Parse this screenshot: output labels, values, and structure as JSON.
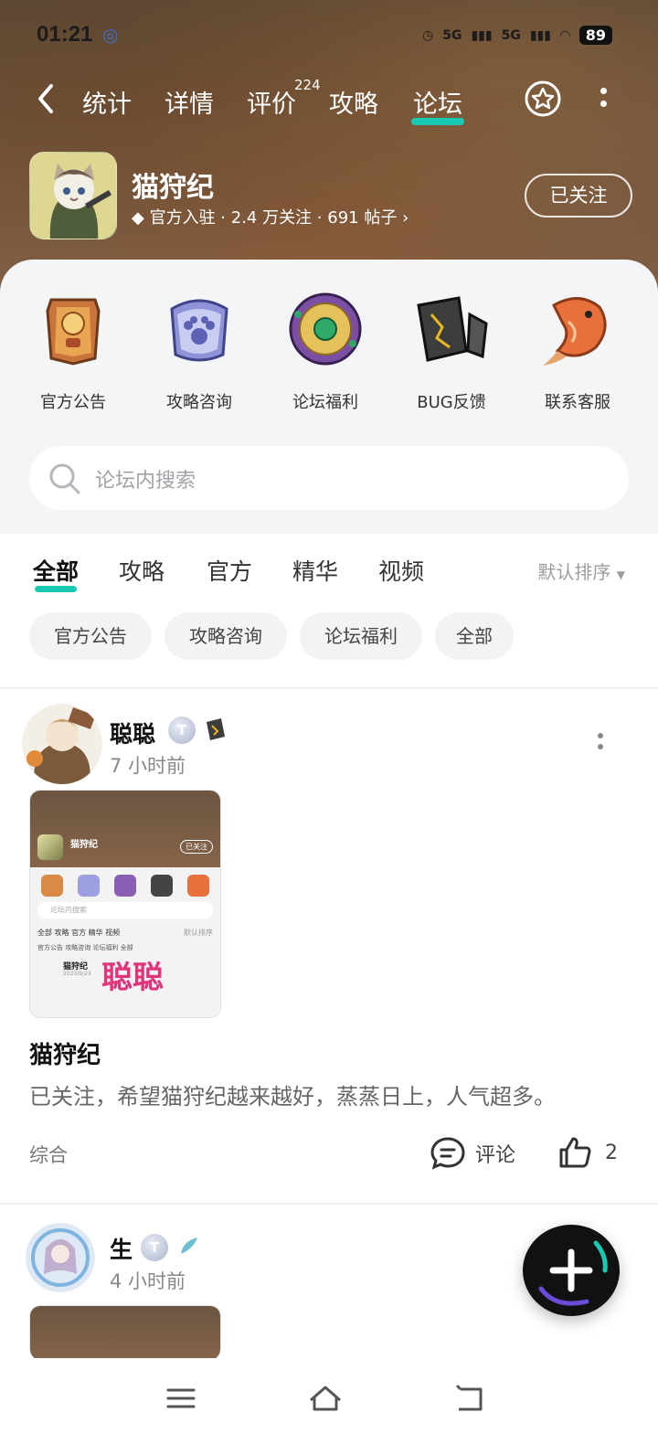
{
  "status_bar": {
    "time": "01:21",
    "network_1": "5G",
    "network_2": "5G",
    "battery": "89"
  },
  "nav": {
    "tabs": [
      {
        "label": "统计"
      },
      {
        "label": "详情"
      },
      {
        "label": "评价"
      },
      {
        "label": "攻略"
      },
      {
        "label": "论坛"
      }
    ],
    "review_count": "224",
    "active_tab": "论坛"
  },
  "game": {
    "name": "猫狩纪",
    "meta": "官方入驻 · 2.4 万关注 · 691 帖子",
    "follow_label": "已关注"
  },
  "categories": [
    {
      "label": "官方公告",
      "icon": "gold-badge-icon"
    },
    {
      "label": "攻略咨询",
      "icon": "paw-plaque-icon"
    },
    {
      "label": "论坛福利",
      "icon": "emerald-medal-icon"
    },
    {
      "label": "BUG反馈",
      "icon": "broken-crystal-icon"
    },
    {
      "label": "联系客服",
      "icon": "koi-fish-icon"
    }
  ],
  "search": {
    "placeholder": "论坛内搜索"
  },
  "filter_tabs": [
    {
      "label": "全部"
    },
    {
      "label": "攻略"
    },
    {
      "label": "官方"
    },
    {
      "label": "精华"
    },
    {
      "label": "视频"
    }
  ],
  "sort_label": "默认排序",
  "chips": [
    {
      "label": "官方公告"
    },
    {
      "label": "攻略咨询"
    },
    {
      "label": "论坛福利"
    },
    {
      "label": "全部"
    }
  ],
  "posts": [
    {
      "user": "聪聪",
      "level": "T",
      "time": "7 小时前",
      "title": "猫狩纪",
      "body": "已关注，希望猫狩纪越来越好，蒸蒸日上，人气超多。",
      "tag": "综合",
      "comment_label": "评论",
      "likes": "2",
      "thumb": {
        "game_name": "猫狩纪",
        "follow": "已关注",
        "search": "论坛内搜索",
        "tabs": "全部  攻略  官方  精华  视频",
        "sort": "默认排序",
        "chips": "官方公告   攻略咨询   论坛福利   全部",
        "user": "猫狩纪",
        "date": "2025/9/23",
        "big_text": "聪聪"
      }
    },
    {
      "user": "生",
      "level": "T",
      "time": "4 小时前"
    }
  ],
  "colors": {
    "accent": "#18c9b3",
    "header_brown": "#7d5e44",
    "panel_bg": "#f4f5f7",
    "thumb_pink": "#e0357a"
  }
}
